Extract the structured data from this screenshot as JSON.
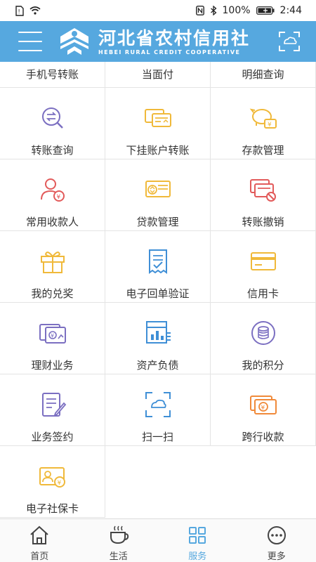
{
  "status_bar": {
    "battery": "100%",
    "time": "2:44",
    "icons": [
      "sim-icon",
      "wifi-icon",
      "nfc-icon",
      "bluetooth-icon",
      "battery-icon"
    ]
  },
  "header": {
    "logo_cn": "河北省农村信用社",
    "logo_en": "HEBEI RURAL CREDIT COOPERATIVE",
    "menu_icon": "menu-icon",
    "scan_icon": "scan-icon",
    "header_color": "#56a8df"
  },
  "grid": {
    "top_row": [
      {
        "label": "手机号转账"
      },
      {
        "label": "当面付"
      },
      {
        "label": "明细查询"
      }
    ],
    "items": [
      {
        "label": "转账查询",
        "icon": "transfer-search-icon"
      },
      {
        "label": "下挂账户转账",
        "icon": "linked-cards-icon"
      },
      {
        "label": "存款管理",
        "icon": "piggy-bank-icon"
      },
      {
        "label": "常用收款人",
        "icon": "payee-icon"
      },
      {
        "label": "贷款管理",
        "icon": "loan-card-icon"
      },
      {
        "label": "转账撤销",
        "icon": "transfer-cancel-icon"
      },
      {
        "label": "我的兑奖",
        "icon": "gift-icon"
      },
      {
        "label": "电子回单验证",
        "icon": "receipt-icon"
      },
      {
        "label": "信用卡",
        "icon": "credit-card-icon"
      },
      {
        "label": "理财业务",
        "icon": "wealth-icon"
      },
      {
        "label": "资产负债",
        "icon": "assets-chart-icon"
      },
      {
        "label": "我的积分",
        "icon": "points-icon"
      },
      {
        "label": "业务签约",
        "icon": "contract-icon"
      },
      {
        "label": "扫一扫",
        "icon": "scan-cloud-icon"
      },
      {
        "label": "跨行收款",
        "icon": "interbank-icon"
      },
      {
        "label": "电子社保卡",
        "icon": "social-security-card-icon"
      }
    ]
  },
  "tabbar": {
    "tabs": [
      {
        "label": "首页",
        "icon": "home-icon"
      },
      {
        "label": "生活",
        "icon": "coffee-icon"
      },
      {
        "label": "服务",
        "icon": "service-icon"
      },
      {
        "label": "更多",
        "icon": "more-icon"
      }
    ],
    "active_index": 2
  },
  "colors": {
    "accent": "#56a8df",
    "icon_purple": "#7b6fc1",
    "icon_gold": "#f0b93a",
    "icon_red": "#e25a5a",
    "icon_blue": "#3f8fd6",
    "icon_orange": "#f08a3a"
  }
}
